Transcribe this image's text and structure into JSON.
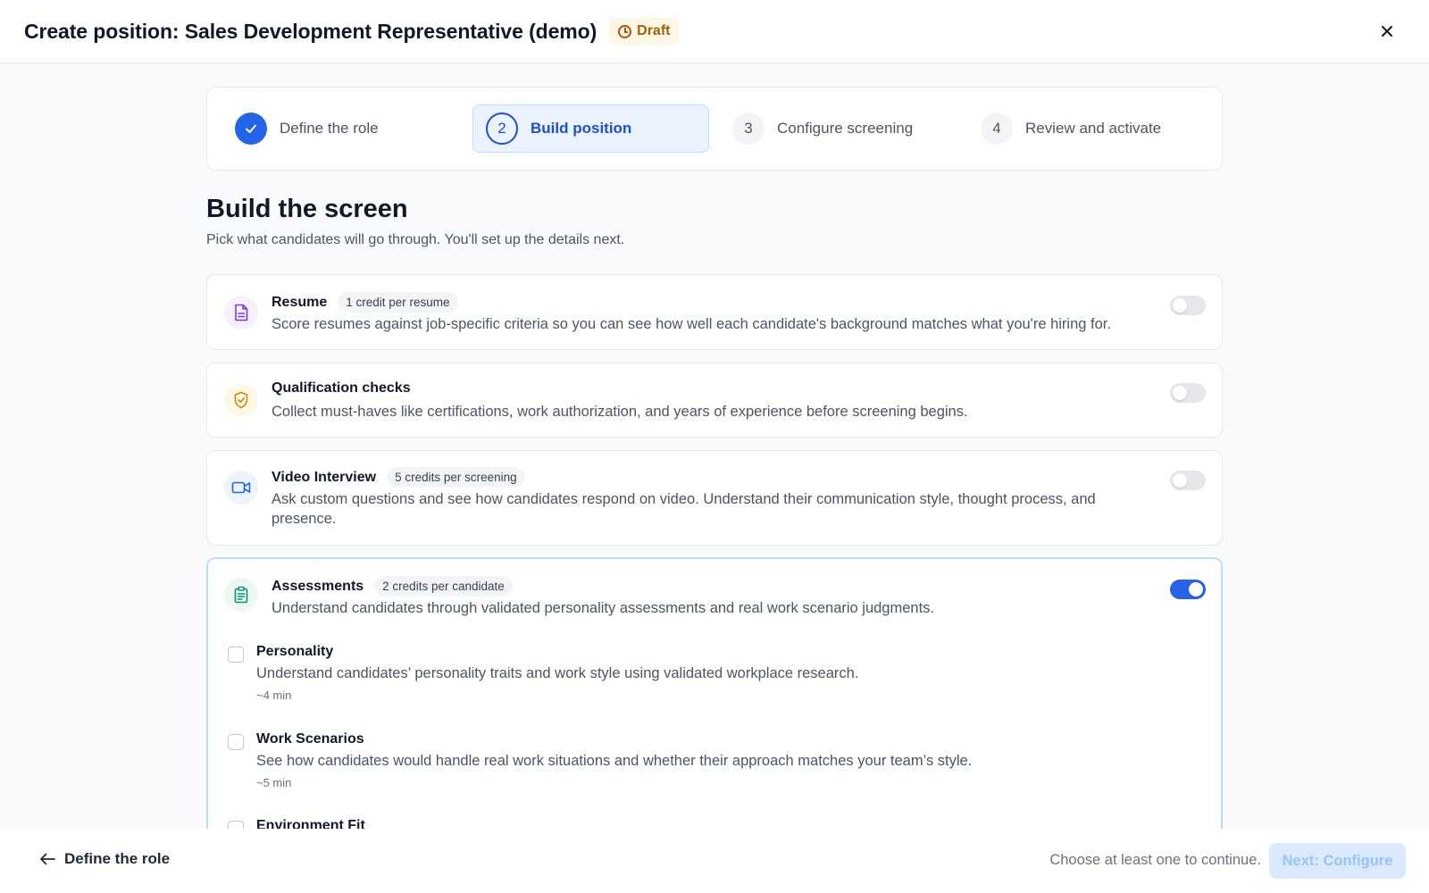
{
  "header": {
    "title": "Create position: Sales Development Representative (demo)",
    "status_badge": "Draft",
    "close_icon": "close-icon"
  },
  "stepper": {
    "steps": [
      {
        "number": "",
        "label": "Define the role",
        "state": "completed"
      },
      {
        "number": "2",
        "label": "Build position",
        "state": "active"
      },
      {
        "number": "3",
        "label": "Configure screening",
        "state": "upcoming"
      },
      {
        "number": "4",
        "label": "Review and activate",
        "state": "upcoming"
      }
    ]
  },
  "section": {
    "title": "Build the screen",
    "subtitle": "Pick what candidates will go through. You'll set up the details next."
  },
  "cards": [
    {
      "icon": "document-icon",
      "title": "Resume",
      "credits": "1 credit per resume",
      "description": "Score resumes against job-specific criteria so you can see how well each candidate's background matches what you're hiring for.",
      "enabled": false
    },
    {
      "icon": "shield-check-icon",
      "title": "Qualification checks",
      "credits": "",
      "description": "Collect must-haves like certifications, work authorization, and years of experience before screening begins.",
      "enabled": false
    },
    {
      "icon": "video-camera-icon",
      "title": "Video Interview",
      "credits": "5 credits per screening",
      "description_line1": "Ask custom questions and see how candidates respond on video. Understand their communication style, thought process, and",
      "description_line2": "presence.",
      "enabled": false
    },
    {
      "icon": "clipboard-icon",
      "title": "Assessments",
      "credits": "2 credits per candidate",
      "description": "Understand candidates through validated personality assessments and real work scenario judgments.",
      "enabled": true,
      "options": [
        {
          "title": "Personality",
          "description": "Understand candidates’ personality traits and work style using validated workplace research.",
          "duration": "~4 min",
          "checked": false
        },
        {
          "title": "Work Scenarios",
          "description": "See how candidates would handle real work situations and whether their approach matches your team’s style.",
          "duration": "~5 min",
          "checked": false
        },
        {
          "title": "Environment Fit",
          "checked": false
        }
      ]
    }
  ],
  "footer": {
    "back_label": "Define the role",
    "hint": "Choose at least one to continue.",
    "next_label": "Next: Configure"
  },
  "colors": {
    "accent": "#2563eb",
    "draft_badge_bg": "#fef7e6",
    "draft_badge_text": "#a16207"
  }
}
